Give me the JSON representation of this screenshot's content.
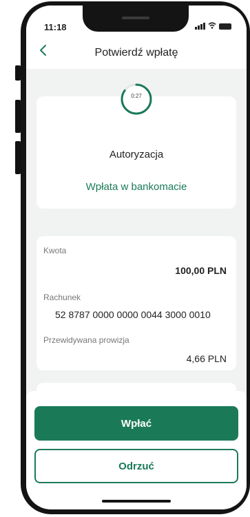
{
  "status_bar": {
    "time": "11:18"
  },
  "header": {
    "title": "Potwierdź wpłatę",
    "back_icon": "chevron-left-icon"
  },
  "authorization": {
    "timer": "0:27",
    "timer_progress_fraction": 0.85,
    "title": "Autoryzacja",
    "link_text": "Wpłata w bankomacie"
  },
  "details": {
    "amount_label": "Kwota",
    "amount_value": "100,00 PLN",
    "account_label": "Rachunek",
    "account_value": "52 8787 0000 0000 0044 3000 0010",
    "fee_label": "Przewidywana prowizja",
    "fee_value": "4,66 PLN"
  },
  "actions": {
    "confirm_label": "Wpłać",
    "reject_label": "Odrzuć"
  },
  "colors": {
    "accent": "#1a7a57",
    "background": "#f1f2f2"
  }
}
